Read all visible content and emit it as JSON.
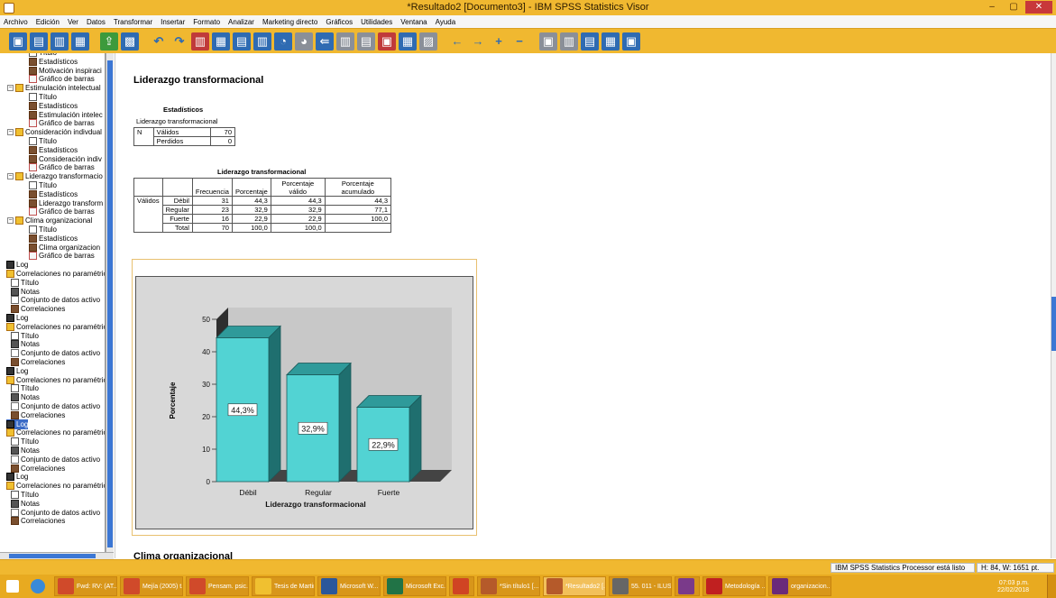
{
  "window": {
    "title": "*Resultado2 [Documento3] - IBM SPSS Statistics Visor",
    "min": "–",
    "max": "▢",
    "close": "✕"
  },
  "menu": [
    "Archivo",
    "Edición",
    "Ver",
    "Datos",
    "Transformar",
    "Insertar",
    "Formato",
    "Analizar",
    "Marketing directo",
    "Gráficos",
    "Utilidades",
    "Ventana",
    "Ayuda"
  ],
  "toolbar": {
    "icons": [
      "open-icon",
      "save-icon",
      "print-icon",
      "print-preview-icon",
      "export-icon",
      "recall-dialog-icon",
      "undo-icon",
      "redo-icon",
      "goto-case-icon",
      "goto-variable-icon",
      "variables-icon",
      "select-cases-icon",
      "show-icon",
      "hide-icon",
      "promote-icon",
      "demote-icon",
      "insert-heading-icon",
      "insert-title-icon",
      "insert-text-icon",
      "insert-output-icon",
      "back-icon",
      "forward-icon",
      "expand-icon",
      "collapse-icon",
      "designate-window-icon",
      "book-icon",
      "insert-table-icon",
      "new-window-icon",
      "insert-image-icon"
    ]
  },
  "nav": {
    "items": [
      {
        "label": "Título",
        "level": 3,
        "icon": "title"
      },
      {
        "label": "Estadísticos",
        "level": 3,
        "icon": "stats"
      },
      {
        "label": "Motivación inspiraci",
        "level": 3,
        "icon": "stats"
      },
      {
        "label": "Gráfico de barras",
        "level": 3,
        "icon": "chart"
      },
      {
        "label": "Estimulación intelectual",
        "level": 2,
        "icon": "node",
        "toggle": "−"
      },
      {
        "label": "Título",
        "level": 3,
        "icon": "title"
      },
      {
        "label": "Estadísticos",
        "level": 3,
        "icon": "stats"
      },
      {
        "label": "Estimulación intelec",
        "level": 3,
        "icon": "stats"
      },
      {
        "label": "Gráfico de barras",
        "level": 3,
        "icon": "chart"
      },
      {
        "label": "Consideración indivdual",
        "level": 2,
        "icon": "node",
        "toggle": "−"
      },
      {
        "label": "Título",
        "level": 3,
        "icon": "title"
      },
      {
        "label": "Estadísticos",
        "level": 3,
        "icon": "stats"
      },
      {
        "label": "Consideración indiv",
        "level": 3,
        "icon": "stats"
      },
      {
        "label": "Gráfico de barras",
        "level": 3,
        "icon": "chart"
      },
      {
        "label": "Liderazgo transformacio",
        "level": 2,
        "icon": "node",
        "toggle": "−"
      },
      {
        "label": "Título",
        "level": 3,
        "icon": "title"
      },
      {
        "label": "Estadísticos",
        "level": 3,
        "icon": "stats"
      },
      {
        "label": "Liderazgo transform",
        "level": 3,
        "icon": "stats"
      },
      {
        "label": "Gráfico de barras",
        "level": 3,
        "icon": "chart"
      },
      {
        "label": "Clima organizacional",
        "level": 2,
        "icon": "node",
        "toggle": "−"
      },
      {
        "label": "Título",
        "level": 3,
        "icon": "title"
      },
      {
        "label": "Estadísticos",
        "level": 3,
        "icon": "stats"
      },
      {
        "label": "Clima organizacion",
        "level": 3,
        "icon": "stats"
      },
      {
        "label": "Gráfico de barras",
        "level": 3,
        "icon": "chart"
      },
      {
        "label": "Log",
        "level": 1,
        "icon": "log"
      },
      {
        "label": "Correlaciones no paramétric",
        "level": 1,
        "icon": "node"
      },
      {
        "label": "Título",
        "level": 2,
        "icon": "title"
      },
      {
        "label": "Notas",
        "level": 2,
        "icon": "notes"
      },
      {
        "label": "Conjunto de datos activo",
        "level": 2,
        "icon": "data"
      },
      {
        "label": "Correlaciones",
        "level": 2,
        "icon": "stats"
      },
      {
        "label": "Log",
        "level": 1,
        "icon": "log"
      },
      {
        "label": "Correlaciones no paramétric",
        "level": 1,
        "icon": "node"
      },
      {
        "label": "Título",
        "level": 2,
        "icon": "title"
      },
      {
        "label": "Notas",
        "level": 2,
        "icon": "notes"
      },
      {
        "label": "Conjunto de datos activo",
        "level": 2,
        "icon": "data"
      },
      {
        "label": "Correlaciones",
        "level": 2,
        "icon": "stats"
      },
      {
        "label": "Log",
        "level": 1,
        "icon": "log"
      },
      {
        "label": "Correlaciones no paramétric",
        "level": 1,
        "icon": "node"
      },
      {
        "label": "Título",
        "level": 2,
        "icon": "title"
      },
      {
        "label": "Notas",
        "level": 2,
        "icon": "notes"
      },
      {
        "label": "Conjunto de datos activo",
        "level": 2,
        "icon": "data"
      },
      {
        "label": "Correlaciones",
        "level": 2,
        "icon": "stats"
      },
      {
        "label": "Log",
        "level": 1,
        "icon": "log",
        "selected": true
      },
      {
        "label": "Correlaciones no paramétric",
        "level": 1,
        "icon": "node"
      },
      {
        "label": "Título",
        "level": 2,
        "icon": "title"
      },
      {
        "label": "Notas",
        "level": 2,
        "icon": "notes"
      },
      {
        "label": "Conjunto de datos activo",
        "level": 2,
        "icon": "data"
      },
      {
        "label": "Correlaciones",
        "level": 2,
        "icon": "stats"
      },
      {
        "label": "Log",
        "level": 1,
        "icon": "log"
      },
      {
        "label": "Correlaciones no paramétric",
        "level": 1,
        "icon": "node"
      },
      {
        "label": "Título",
        "level": 2,
        "icon": "title"
      },
      {
        "label": "Notas",
        "level": 2,
        "icon": "notes"
      },
      {
        "label": "Conjunto de datos activo",
        "level": 2,
        "icon": "data"
      },
      {
        "label": "Correlaciones",
        "level": 2,
        "icon": "stats"
      }
    ]
  },
  "output": {
    "heading": "Liderazgo transformacional",
    "stats_table": {
      "title": "Estadísticos",
      "subtitle": "Liderazgo transformacional",
      "rows": [
        {
          "c1": "N",
          "c2": "Válidos",
          "c3": "70"
        },
        {
          "c1": "",
          "c2": "Perdidos",
          "c3": "0"
        }
      ]
    },
    "freq_table": {
      "title": "Liderazgo transformacional",
      "headers": [
        "",
        "",
        "Frecuencia",
        "Porcentaje",
        "Porcentaje válido",
        "Porcentaje acumulado"
      ],
      "rows": [
        [
          "Válidos",
          "Débil",
          "31",
          "44,3",
          "44,3",
          "44,3"
        ],
        [
          "",
          "Regular",
          "23",
          "32,9",
          "32,9",
          "77,1"
        ],
        [
          "",
          "Fuerte",
          "16",
          "22,9",
          "22,9",
          "100,0"
        ],
        [
          "",
          "Total",
          "70",
          "100,0",
          "100,0",
          ""
        ]
      ]
    },
    "next_heading": "Clima organizacional"
  },
  "chart_data": {
    "type": "bar",
    "categories": [
      "Débil",
      "Regular",
      "Fuerte"
    ],
    "values": [
      44.3,
      32.9,
      22.9
    ],
    "data_labels": [
      "44,3%",
      "32,9%",
      "22,9%"
    ],
    "xlabel": "Liderazgo transformacional",
    "ylabel": "Porcentaje",
    "ylim": [
      0,
      50
    ],
    "yticks": [
      "0",
      "10",
      "20",
      "30",
      "40",
      "50"
    ],
    "bar_color": "#52d3d3",
    "background": "#d8d8d8"
  },
  "status": {
    "message": "IBM SPSS Statistics Processor está listo",
    "dims": "H: 84, W: 1651 pt."
  },
  "taskbar": {
    "items": [
      {
        "label": "Fwd: RV: (AT...",
        "color": "#d04a2a"
      },
      {
        "label": "Mejía (2005) t...",
        "color": "#d04a2a"
      },
      {
        "label": "Pensam. psic...",
        "color": "#d04a2a"
      },
      {
        "label": "Tesis de Martin",
        "color": "#f0c030"
      },
      {
        "label": "Microsoft W...",
        "color": "#2b579a"
      },
      {
        "label": "Microsoft Exc...",
        "color": "#217346"
      },
      {
        "label": "",
        "color": "#d04423"
      },
      {
        "label": "*Sin título1 [...",
        "color": "#b55a2a"
      },
      {
        "label": "*Resultado2 [...",
        "color": "#b55a2a",
        "active": true
      },
      {
        "label": "55. 011 - ILUS...",
        "color": "#666"
      },
      {
        "label": "",
        "color": "#7a3a8a"
      },
      {
        "label": "Metodología ...",
        "color": "#c02020"
      },
      {
        "label": "organizacion...",
        "color": "#6a2a7a"
      }
    ],
    "time": "07:03 p.m.",
    "date": "22/02/2018"
  }
}
